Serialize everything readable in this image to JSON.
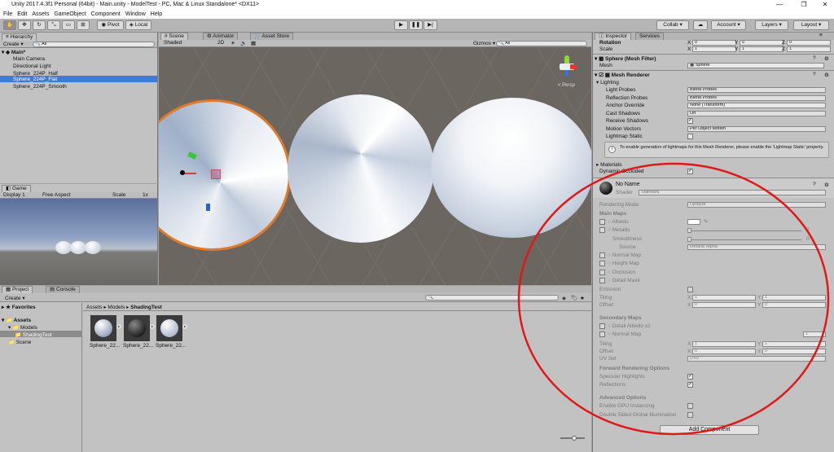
{
  "app": {
    "title": "Unity 2017.4.3f1 Personal (64bit) - Main.unity - ModelTest - PC, Mac & Linux Standalone* <DX11>"
  },
  "menu": [
    "File",
    "Edit",
    "Assets",
    "GameObject",
    "Component",
    "Window",
    "Help"
  ],
  "toolbar": {
    "pivot": "Pivot",
    "local": "Local",
    "collab": "Collab ▾",
    "account": "Account ▾",
    "layers": "Layers ▾",
    "layout": "Layout ▾"
  },
  "hierarchy": {
    "tab": "Hierarchy",
    "create": "Create ▾",
    "search_placeholder": "All",
    "scene": "Main*",
    "items": [
      "Main Camera",
      "Directional Light",
      "Sphere_224P_Half",
      "Sphere_224P_Flat",
      "Sphere_224P_Smooth"
    ],
    "selected_index": 3
  },
  "scene": {
    "tabs": [
      "Scene",
      "Animator",
      "Asset Store"
    ],
    "shaded": "Shaded",
    "mode2d": "2D",
    "gizmos": "Gizmos ▾",
    "search_placeholder": "All",
    "persp": "< Persp"
  },
  "game": {
    "tab": "Game",
    "display": "Display 1",
    "aspect": "Free Aspect",
    "scale_label": "Scale",
    "scale_value": "1x"
  },
  "project": {
    "tabs": [
      "Project",
      "Console"
    ],
    "create": "Create ▾",
    "tree": {
      "favorites": "Favorites",
      "assets": "Assets",
      "models": "Models",
      "shadingtest": "ShadingTest",
      "scene": "Scene"
    },
    "breadcrumb": [
      "Assets",
      "Models",
      "ShadingTest"
    ],
    "assets": [
      "Sphere_22...",
      "Sphere_22...",
      "Sphere_22..."
    ]
  },
  "inspector": {
    "tabs": [
      "Inspector",
      "Services"
    ],
    "transform": {
      "rotation": "Rotation",
      "scale": "Scale",
      "x": "0",
      "y": "0",
      "z": "0",
      "sx": "1",
      "sy": "1",
      "sz": "1"
    },
    "meshfilter": {
      "title": "Sphere (Mesh Filter)",
      "mesh_label": "Mesh",
      "mesh_value": "Sphere"
    },
    "meshrenderer": {
      "title": "Mesh Renderer",
      "lighting": "Lighting",
      "rows": [
        {
          "label": "Light Probes",
          "value": "Blend Probes"
        },
        {
          "label": "Reflection Probes",
          "value": "Blend Probes"
        },
        {
          "label": "Anchor Override",
          "value": "None (Transform)"
        },
        {
          "label": "Cast Shadows",
          "value": "On"
        },
        {
          "label": "Receive Shadows",
          "value": "✓"
        },
        {
          "label": "Motion Vectors",
          "value": "Per Object Motion"
        },
        {
          "label": "Lightmap Static",
          "value": ""
        }
      ],
      "info": "To enable generation of lightmaps for this Mesh Renderer, please enable the 'Lightmap Static' property.",
      "materials": "Materials",
      "dynamic_occluded": "Dynamic Occluded"
    },
    "material": {
      "name": "No Name",
      "shader_label": "Shader",
      "shader_value": "Standard",
      "rendering_mode_label": "Rendering Mode",
      "rendering_mode_value": "Opaque",
      "main_maps": "Main Maps",
      "albedo": "Albedo",
      "metallic": "Metallic",
      "metallic_value": "0",
      "smoothness": "Smoothness",
      "smoothness_value": "0",
      "source": "Source",
      "source_value": "Metallic Alpha",
      "normal_map": "Normal Map",
      "height_map": "Height Map",
      "occlusion": "Occlusion",
      "detail_mask": "Detail Mask",
      "emission": "Emission",
      "tiling": "Tiling",
      "offset": "Offset",
      "tx": "1",
      "ty": "1",
      "ox": "0",
      "oy": "0",
      "secondary_maps": "Secondary Maps",
      "detail_albedo": "Detail Albedo x2",
      "sec_normal_map": "Normal Map",
      "sec_normal_value": "1",
      "uv_set": "UV Set",
      "uv_value": "UV0",
      "forward": "Forward Rendering Options",
      "specular": "Specular Highlights",
      "reflections": "Reflections",
      "advanced": "Advanced Options",
      "gpu": "Enable GPU Instancing",
      "dsgi": "Double Sided Global Illumination"
    },
    "add_component": "Add Component"
  }
}
